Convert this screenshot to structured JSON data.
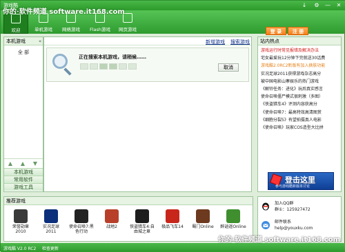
{
  "window": {
    "title": "游戏酷"
  },
  "watermark": {
    "top": "你的·软件频道  software.it168.com",
    "bottom": "你的·软件频道  software.it168.com"
  },
  "window_controls": [
    "↓",
    "⚙",
    "—",
    "✕"
  ],
  "toolbar": {
    "items": [
      {
        "label": "欢迎",
        "icon": "home-icon",
        "active": true
      },
      {
        "label": "单机游戏",
        "icon": "single-player-icon",
        "active": false
      },
      {
        "label": "网络游戏",
        "icon": "online-game-icon",
        "active": false
      },
      {
        "label": "Flash游戏",
        "icon": "flash-game-icon",
        "active": false
      },
      {
        "label": "网页游戏",
        "icon": "web-game-icon",
        "active": false
      }
    ],
    "login_label": "登 录",
    "register_label": "注 册"
  },
  "left": {
    "title": "本机游戏",
    "collapse": "«",
    "all": "全 部",
    "arrows": [
      "▲",
      "▲",
      "▼"
    ],
    "tabs": [
      "本机游戏",
      "常用软件",
      "游戏工具"
    ]
  },
  "center": {
    "link_new": "新增游戏",
    "link_search": "搜索游戏",
    "loading_text": "正在搜索本机游戏，请稍候……",
    "cancel_label": "取消"
  },
  "news": {
    "title": "站内热点",
    "items": [
      {
        "text": "游戏运行时常见报错及解决办法",
        "color": "red"
      },
      {
        "text": "宅女最爱玩12分钟下完就送30话费",
        "color": "normal"
      },
      {
        "text": "游戏酷2.0RC2新版有加入换肤功能",
        "color": "orange"
      },
      {
        "text": "实况足球2011获得游戏杂志高分",
        "color": "normal"
      },
      {
        "text": "被中国电影山寨娱乐的热门游戏",
        "color": "normal"
      },
      {
        "text": "《解铃任务：进化》玩后真实感言",
        "color": "normal"
      },
      {
        "text": "使命召唤僵尸模式很刺激（多图）",
        "color": "normal"
      },
      {
        "text": "《侠盗猎车4》评测内容获高分",
        "color": "normal"
      },
      {
        "text": "《使命召唤7：最高特效高清图赏",
        "color": "normal"
      },
      {
        "text": "《细胞分裂5》有望拍摄真人电影",
        "color": "normal"
      },
      {
        "text": "《使命召唤》玩家COS造型大比拼",
        "color": "normal"
      }
    ],
    "banner_big": "登击这里",
    "banner_small": "参与游戏酷新版本讨论"
  },
  "recommend": {
    "title": "推荐游戏",
    "games": [
      {
        "name": "荣誉勋章 2010",
        "color": "#3a3a3a"
      },
      {
        "name": "实况足球 2011",
        "color": "#0b2f7a"
      },
      {
        "name": "使命召唤7:黑色行动",
        "color": "#222222"
      },
      {
        "name": "战地2",
        "color": "#b8402a"
      },
      {
        "name": "侠盗猎车4:自由城之章",
        "color": "#1d1d1d"
      },
      {
        "name": "极品飞车14",
        "color": "#c9261b"
      },
      {
        "name": "蜀门Online",
        "color": "#6d3a1f"
      },
      {
        "name": "醉逍遥Online",
        "color": "#3f8f2f"
      }
    ]
  },
  "contact": {
    "qq_title": "加入QQ群",
    "qq_group": "群①：125927472",
    "mail_title": "邮件联系",
    "mail": "help@youxku.com"
  },
  "status": {
    "version": "游戏酷 V2.0 RC2",
    "update": "检查更新"
  }
}
